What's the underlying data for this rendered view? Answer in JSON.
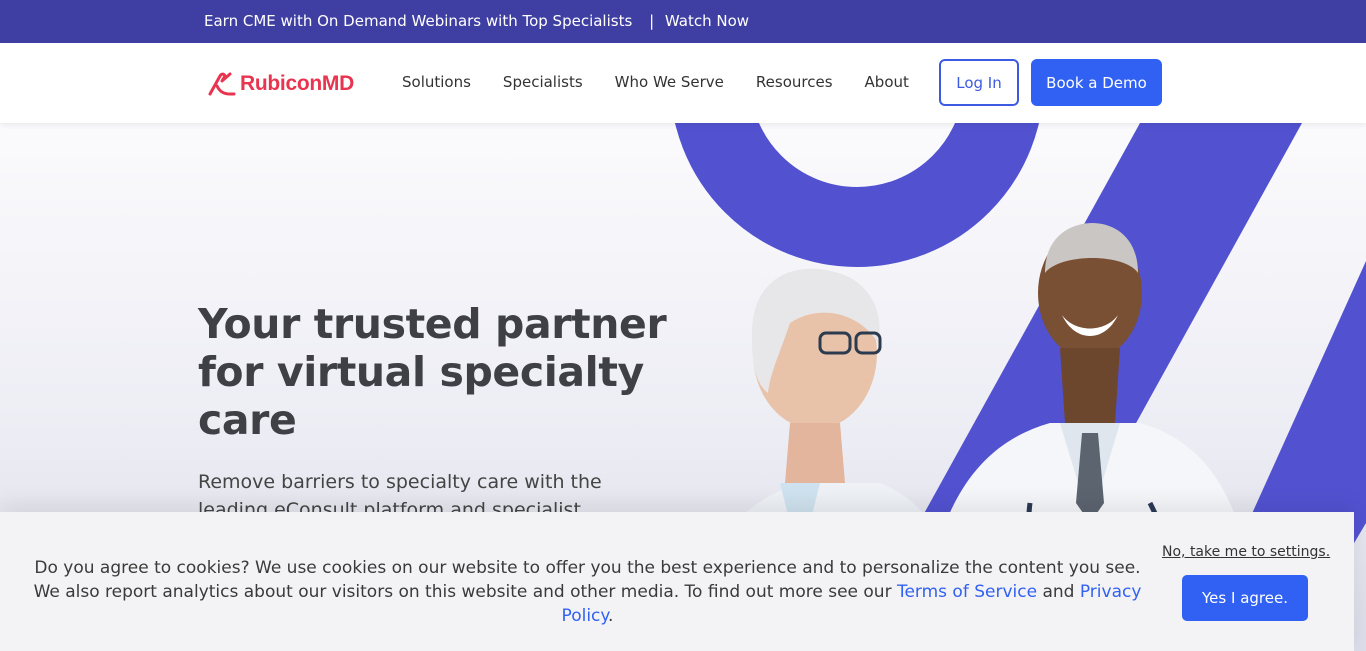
{
  "banner": {
    "text": "Earn CME with On Demand Webinars with Top Specialists",
    "separator": "|",
    "link": "Watch Now"
  },
  "header": {
    "logo_text": "RubiconMD",
    "nav": [
      "Solutions",
      "Specialists",
      "Who We Serve",
      "Resources",
      "About"
    ],
    "login_label": "Log In",
    "demo_label": "Book a Demo"
  },
  "hero": {
    "title": "Your trusted partner for virtual specialty care",
    "subtitle": "Remove barriers to specialty care with the leading eConsult platform and specialist network."
  },
  "cookie": {
    "text_before": "Do you agree to cookies? We use cookies on our website to offer you the best experience and to personalize the content you see. We also report analytics about our visitors on this website and other media. To find out more see our ",
    "terms_link": "Terms of Service",
    "and_text": " and ",
    "privacy_link": "Privacy Policy",
    "period": ".",
    "settings_link": "No, take me to settings.",
    "agree_label": "Yes I agree."
  },
  "colors": {
    "banner_bg": "#3f3fa3",
    "brand_red": "#e8344e",
    "accent_blue": "#3161f2",
    "shape_purple": "#5252d1"
  }
}
